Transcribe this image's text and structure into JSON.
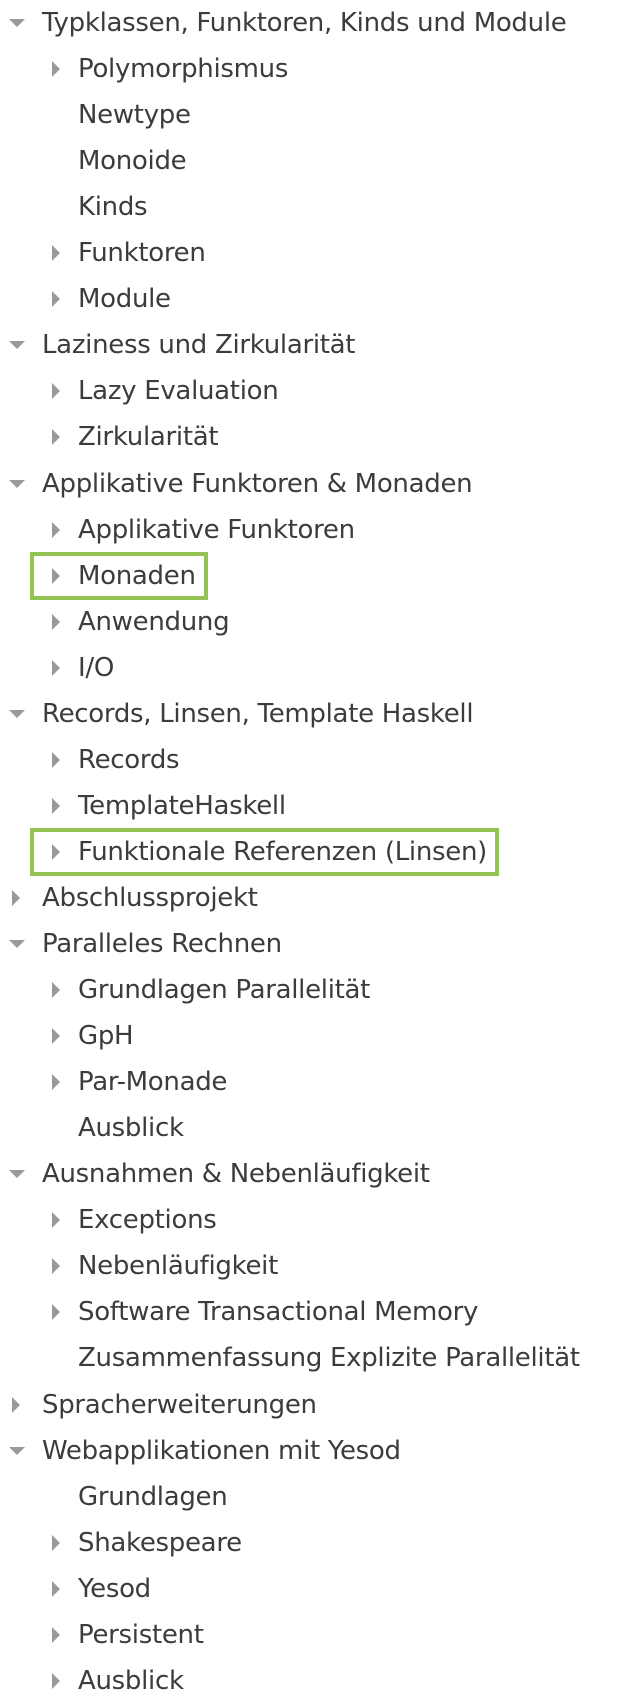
{
  "accent_color": "#92c353",
  "tree": [
    {
      "label": "Typklassen, Funktoren, Kinds und Module",
      "level": 0,
      "twisty": "expanded"
    },
    {
      "label": "Polymorphismus",
      "level": 1,
      "twisty": "collapsed"
    },
    {
      "label": "Newtype",
      "level": 1,
      "twisty": "none"
    },
    {
      "label": "Monoide",
      "level": 1,
      "twisty": "none"
    },
    {
      "label": "Kinds",
      "level": 1,
      "twisty": "none"
    },
    {
      "label": "Funktoren",
      "level": 1,
      "twisty": "collapsed"
    },
    {
      "label": "Module",
      "level": 1,
      "twisty": "collapsed"
    },
    {
      "label": "Laziness und Zirkularität",
      "level": 0,
      "twisty": "expanded"
    },
    {
      "label": "Lazy Evaluation",
      "level": 1,
      "twisty": "collapsed"
    },
    {
      "label": "Zirkularität",
      "level": 1,
      "twisty": "collapsed"
    },
    {
      "label": "Applikative Funktoren & Monaden",
      "level": 0,
      "twisty": "expanded"
    },
    {
      "label": "Applikative Funktoren",
      "level": 1,
      "twisty": "collapsed"
    },
    {
      "label": "Monaden",
      "level": 1,
      "twisty": "collapsed",
      "highlighted": true
    },
    {
      "label": "Anwendung",
      "level": 1,
      "twisty": "collapsed"
    },
    {
      "label": "I/O",
      "level": 1,
      "twisty": "collapsed"
    },
    {
      "label": "Records, Linsen, Template Haskell",
      "level": 0,
      "twisty": "expanded"
    },
    {
      "label": "Records",
      "level": 1,
      "twisty": "collapsed"
    },
    {
      "label": "TemplateHaskell",
      "level": 1,
      "twisty": "collapsed"
    },
    {
      "label": "Funktionale Referenzen (Linsen)",
      "level": 1,
      "twisty": "collapsed",
      "highlighted": true
    },
    {
      "label": "Abschlussprojekt",
      "level": 0,
      "twisty": "collapsed"
    },
    {
      "label": "Paralleles Rechnen",
      "level": 0,
      "twisty": "expanded"
    },
    {
      "label": "Grundlagen Parallelität",
      "level": 1,
      "twisty": "collapsed"
    },
    {
      "label": "GpH",
      "level": 1,
      "twisty": "collapsed"
    },
    {
      "label": "Par-Monade",
      "level": 1,
      "twisty": "collapsed"
    },
    {
      "label": "Ausblick",
      "level": 1,
      "twisty": "none"
    },
    {
      "label": "Ausnahmen & Nebenläufigkeit",
      "level": 0,
      "twisty": "expanded"
    },
    {
      "label": "Exceptions",
      "level": 1,
      "twisty": "collapsed"
    },
    {
      "label": "Nebenläufigkeit",
      "level": 1,
      "twisty": "collapsed"
    },
    {
      "label": "Software Transactional Memory",
      "level": 1,
      "twisty": "collapsed"
    },
    {
      "label": "Zusammenfassung Explizite Parallelität",
      "level": 1,
      "twisty": "none"
    },
    {
      "label": "Spracherweiterungen",
      "level": 0,
      "twisty": "collapsed"
    },
    {
      "label": "Webapplikationen mit Yesod",
      "level": 0,
      "twisty": "expanded"
    },
    {
      "label": "Grundlagen",
      "level": 1,
      "twisty": "none"
    },
    {
      "label": "Shakespeare",
      "level": 1,
      "twisty": "collapsed"
    },
    {
      "label": "Yesod",
      "level": 1,
      "twisty": "collapsed"
    },
    {
      "label": "Persistent",
      "level": 1,
      "twisty": "collapsed"
    },
    {
      "label": "Ausblick",
      "level": 1,
      "twisty": "collapsed"
    }
  ]
}
